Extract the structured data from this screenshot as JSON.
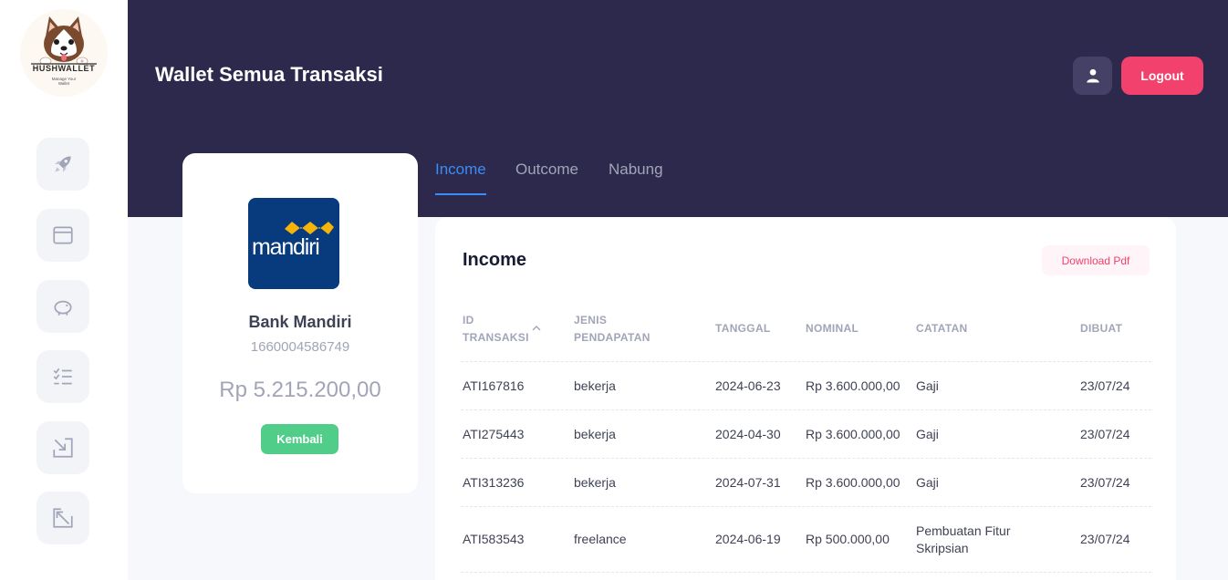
{
  "logo": {
    "title": "HUSHWALLET",
    "subtitle": "Manage Your Wallet"
  },
  "sidebar": {
    "items": [
      {
        "name": "dashboard",
        "icon": "rocket-icon"
      },
      {
        "name": "wallet",
        "icon": "wallet-icon"
      },
      {
        "name": "savings",
        "icon": "piggy-bank-icon"
      },
      {
        "name": "transactions",
        "icon": "list-check-icon"
      },
      {
        "name": "income",
        "icon": "arrow-in-icon"
      },
      {
        "name": "outcome",
        "icon": "arrow-out-icon"
      }
    ]
  },
  "header": {
    "title": "Wallet Semua Transaksi",
    "logout_label": "Logout"
  },
  "tabs": [
    {
      "label": "Income",
      "active": true
    },
    {
      "label": "Outcome",
      "active": false
    },
    {
      "label": "Nabung",
      "active": false
    }
  ],
  "bank": {
    "logo_text": "mandiri",
    "name": "Bank Mandiri",
    "account_number": "1660004586749",
    "balance": "Rp 5.215.200,00",
    "back_label": "Kembali"
  },
  "panel": {
    "title": "Income",
    "download_label": "Download Pdf",
    "columns": [
      [
        "ID",
        "TRANSAKSI"
      ],
      [
        "JENIS",
        "PENDAPATAN"
      ],
      [
        "TANGGAL"
      ],
      [
        "NOMINAL"
      ],
      [
        "CATATAN"
      ],
      [
        "DIBUAT"
      ]
    ],
    "rows": [
      {
        "id": "ATI167816",
        "jenis": "bekerja",
        "tanggal": "2024-06-23",
        "nominal": "Rp 3.600.000,00",
        "catatan": [
          "Gaji"
        ],
        "dibuat": "23/07/24"
      },
      {
        "id": "ATI275443",
        "jenis": "bekerja",
        "tanggal": "2024-04-30",
        "nominal": "Rp 3.600.000,00",
        "catatan": [
          "Gaji"
        ],
        "dibuat": "23/07/24"
      },
      {
        "id": "ATI313236",
        "jenis": "bekerja",
        "tanggal": "2024-07-31",
        "nominal": "Rp 3.600.000,00",
        "catatan": [
          "Gaji"
        ],
        "dibuat": "23/07/24"
      },
      {
        "id": "ATI583543",
        "jenis": "freelance",
        "tanggal": "2024-06-19",
        "nominal": "Rp 500.000,00",
        "catatan": [
          "Pembuatan Fitur",
          "Skripsian"
        ],
        "dibuat": "23/07/24"
      }
    ]
  },
  "colors": {
    "header_bg": "#2d294c",
    "logout": "#f1416c",
    "active_tab": "#3b8cf4",
    "back_button": "#50cd89"
  }
}
